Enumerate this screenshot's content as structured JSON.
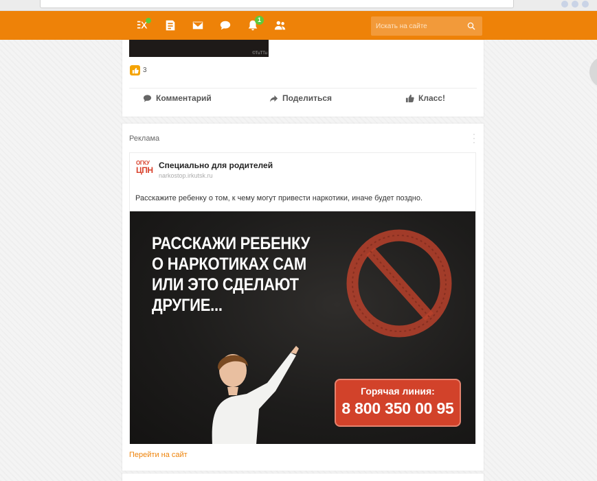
{
  "toolbar": {
    "icons": [
      "friends-activity-icon",
      "feed-icon",
      "messages-icon",
      "discussions-icon",
      "notifications-icon",
      "guests-icon"
    ],
    "notifications_badge": "1",
    "search_placeholder": "Искать на сайте",
    "accent_color": "#ee8208",
    "badge_color": "#5fc93b"
  },
  "post": {
    "image_caption": "©TuTTu",
    "like_count": "3",
    "actions": {
      "comment": "Комментарий",
      "share": "Поделиться",
      "class": "Класс!"
    }
  },
  "ad": {
    "label": "Реклама",
    "logo_top": "ОГКУ",
    "logo_bottom": "ЦПН",
    "title": "Специально для родителей",
    "domain": "narkostop.irkutsk.ru",
    "text": "Расскажите ребенку о том, к чему могут привести наркотики, иначе будет поздно.",
    "banner": {
      "headline": [
        "РАССКАЖИ РЕБЕНКУ",
        "О НАРКОТИКАХ САМ",
        "ИЛИ ЭТО СДЕЛАЮТ",
        "ДРУГИЕ..."
      ],
      "hotline_label": "Горячая линия:",
      "hotline_number": "8 800 350 00 95",
      "hotline_color": "#d2422a"
    },
    "link": "Перейти на сайт"
  }
}
